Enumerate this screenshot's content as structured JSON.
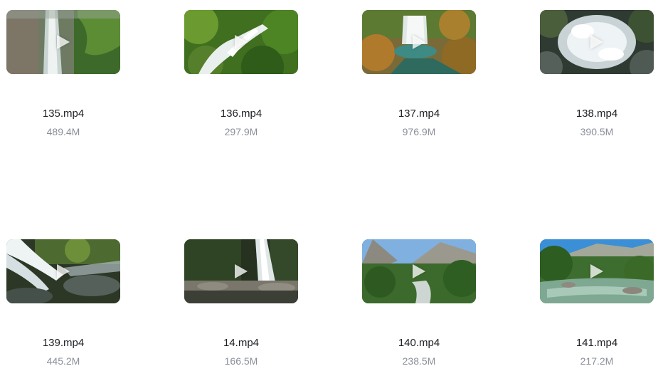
{
  "files": [
    {
      "name": "135.mp4",
      "size": "489.4M",
      "thumbnail": "waterfall-cliff",
      "colors": [
        "#6b7a5d",
        "#3f5a2d",
        "#c9d6d4"
      ]
    },
    {
      "name": "136.mp4",
      "size": "297.9M",
      "thumbnail": "mossy-cascade",
      "colors": [
        "#5d8b2a",
        "#2f5e1a",
        "#e9f0ee"
      ]
    },
    {
      "name": "137.mp4",
      "size": "976.9M",
      "thumbnail": "autumn-waterfall",
      "colors": [
        "#9a7a3a",
        "#4a6a2a",
        "#dfe8e4"
      ]
    },
    {
      "name": "138.mp4",
      "size": "390.5M",
      "thumbnail": "whitewater-rocks",
      "colors": [
        "#4a5a4f",
        "#253028",
        "#f2f5f6"
      ]
    },
    {
      "name": "139.mp4",
      "size": "445.2M",
      "thumbnail": "rapids-closeup",
      "colors": [
        "#3a4a34",
        "#1f2a1c",
        "#eef2f3"
      ]
    },
    {
      "name": "14.mp4",
      "size": "166.5M",
      "thumbnail": "forest-pool-falls",
      "colors": [
        "#2e3b2a",
        "#6f6a5e",
        "#dfe6e4"
      ]
    },
    {
      "name": "140.mp4",
      "size": "238.5M",
      "thumbnail": "valley-river",
      "colors": [
        "#3f6a2d",
        "#7aa6d8",
        "#c7cfc7"
      ]
    },
    {
      "name": "141.mp4",
      "size": "217.2M",
      "thumbnail": "mountain-river",
      "colors": [
        "#3e6e2f",
        "#3b8fd6",
        "#8fb4a0"
      ]
    }
  ]
}
